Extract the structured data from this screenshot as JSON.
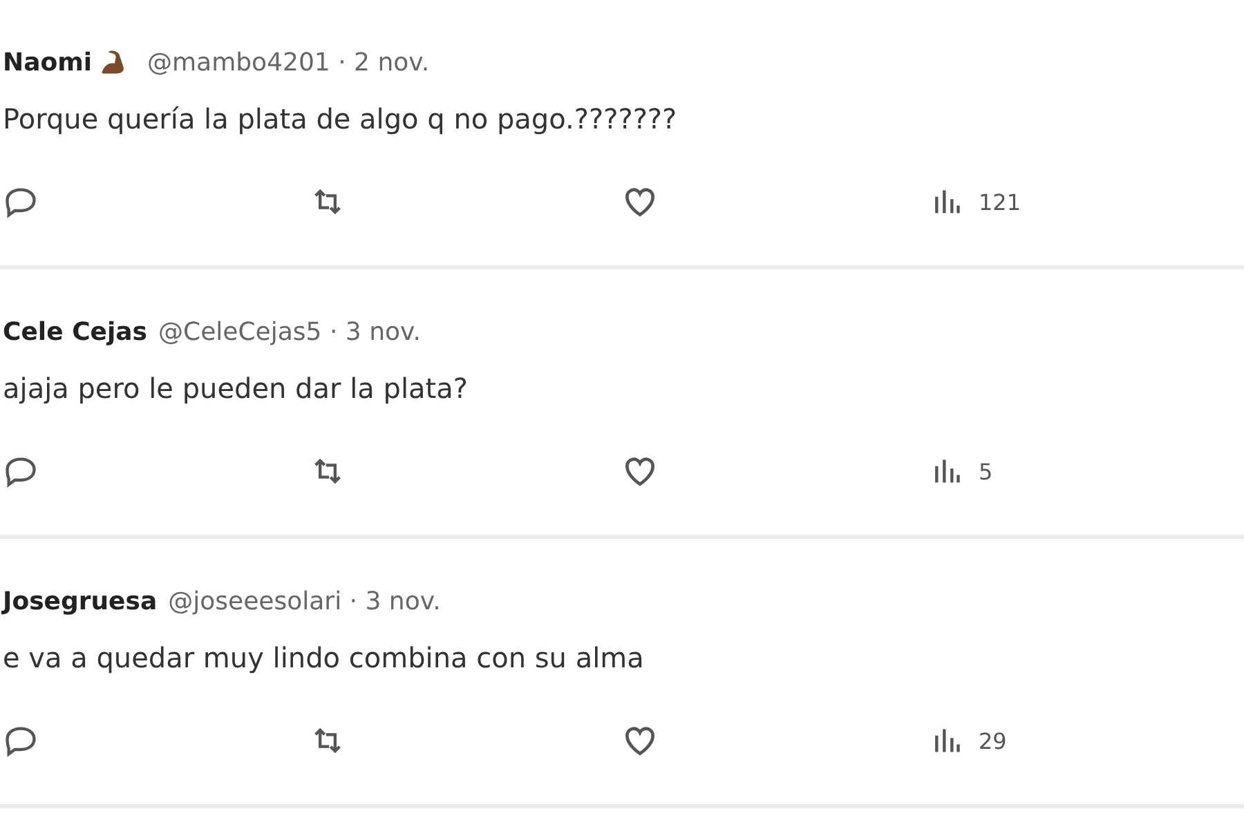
{
  "replies": [
    {
      "name": "Naomi",
      "handle": "@mambo4201",
      "date": "· 2 nov.",
      "emoji": true,
      "text": "Porque quería la plata de algo q no pago.???????",
      "views": "121"
    },
    {
      "name": "Cele Cejas",
      "handle": "@CeleCejas5",
      "date": "· 3 nov.",
      "emoji": false,
      "text": "ajaja pero le pueden dar la plata?",
      "views": "5"
    },
    {
      "name": "Josegruesa",
      "handle": "@joseeesolari",
      "date": "· 3 nov.",
      "emoji": false,
      "text": "e va a quedar muy lindo combina con su alma",
      "views": "29"
    }
  ]
}
